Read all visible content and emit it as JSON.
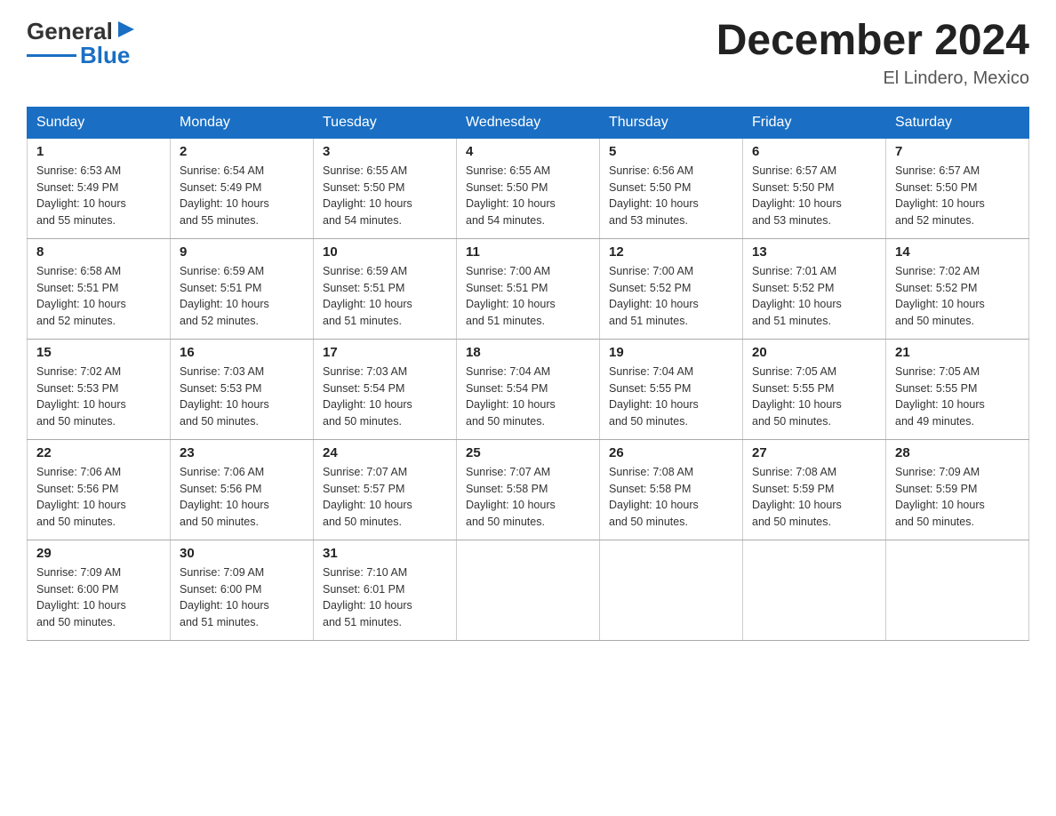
{
  "logo": {
    "text_general": "General",
    "text_blue": "Blue"
  },
  "header": {
    "month_title": "December 2024",
    "location": "El Lindero, Mexico"
  },
  "days_of_week": [
    "Sunday",
    "Monday",
    "Tuesday",
    "Wednesday",
    "Thursday",
    "Friday",
    "Saturday"
  ],
  "weeks": [
    [
      {
        "day": "1",
        "sunrise": "6:53 AM",
        "sunset": "5:49 PM",
        "daylight": "10 hours and 55 minutes."
      },
      {
        "day": "2",
        "sunrise": "6:54 AM",
        "sunset": "5:49 PM",
        "daylight": "10 hours and 55 minutes."
      },
      {
        "day": "3",
        "sunrise": "6:55 AM",
        "sunset": "5:50 PM",
        "daylight": "10 hours and 54 minutes."
      },
      {
        "day": "4",
        "sunrise": "6:55 AM",
        "sunset": "5:50 PM",
        "daylight": "10 hours and 54 minutes."
      },
      {
        "day": "5",
        "sunrise": "6:56 AM",
        "sunset": "5:50 PM",
        "daylight": "10 hours and 53 minutes."
      },
      {
        "day": "6",
        "sunrise": "6:57 AM",
        "sunset": "5:50 PM",
        "daylight": "10 hours and 53 minutes."
      },
      {
        "day": "7",
        "sunrise": "6:57 AM",
        "sunset": "5:50 PM",
        "daylight": "10 hours and 52 minutes."
      }
    ],
    [
      {
        "day": "8",
        "sunrise": "6:58 AM",
        "sunset": "5:51 PM",
        "daylight": "10 hours and 52 minutes."
      },
      {
        "day": "9",
        "sunrise": "6:59 AM",
        "sunset": "5:51 PM",
        "daylight": "10 hours and 52 minutes."
      },
      {
        "day": "10",
        "sunrise": "6:59 AM",
        "sunset": "5:51 PM",
        "daylight": "10 hours and 51 minutes."
      },
      {
        "day": "11",
        "sunrise": "7:00 AM",
        "sunset": "5:51 PM",
        "daylight": "10 hours and 51 minutes."
      },
      {
        "day": "12",
        "sunrise": "7:00 AM",
        "sunset": "5:52 PM",
        "daylight": "10 hours and 51 minutes."
      },
      {
        "day": "13",
        "sunrise": "7:01 AM",
        "sunset": "5:52 PM",
        "daylight": "10 hours and 51 minutes."
      },
      {
        "day": "14",
        "sunrise": "7:02 AM",
        "sunset": "5:52 PM",
        "daylight": "10 hours and 50 minutes."
      }
    ],
    [
      {
        "day": "15",
        "sunrise": "7:02 AM",
        "sunset": "5:53 PM",
        "daylight": "10 hours and 50 minutes."
      },
      {
        "day": "16",
        "sunrise": "7:03 AM",
        "sunset": "5:53 PM",
        "daylight": "10 hours and 50 minutes."
      },
      {
        "day": "17",
        "sunrise": "7:03 AM",
        "sunset": "5:54 PM",
        "daylight": "10 hours and 50 minutes."
      },
      {
        "day": "18",
        "sunrise": "7:04 AM",
        "sunset": "5:54 PM",
        "daylight": "10 hours and 50 minutes."
      },
      {
        "day": "19",
        "sunrise": "7:04 AM",
        "sunset": "5:55 PM",
        "daylight": "10 hours and 50 minutes."
      },
      {
        "day": "20",
        "sunrise": "7:05 AM",
        "sunset": "5:55 PM",
        "daylight": "10 hours and 50 minutes."
      },
      {
        "day": "21",
        "sunrise": "7:05 AM",
        "sunset": "5:55 PM",
        "daylight": "10 hours and 49 minutes."
      }
    ],
    [
      {
        "day": "22",
        "sunrise": "7:06 AM",
        "sunset": "5:56 PM",
        "daylight": "10 hours and 50 minutes."
      },
      {
        "day": "23",
        "sunrise": "7:06 AM",
        "sunset": "5:56 PM",
        "daylight": "10 hours and 50 minutes."
      },
      {
        "day": "24",
        "sunrise": "7:07 AM",
        "sunset": "5:57 PM",
        "daylight": "10 hours and 50 minutes."
      },
      {
        "day": "25",
        "sunrise": "7:07 AM",
        "sunset": "5:58 PM",
        "daylight": "10 hours and 50 minutes."
      },
      {
        "day": "26",
        "sunrise": "7:08 AM",
        "sunset": "5:58 PM",
        "daylight": "10 hours and 50 minutes."
      },
      {
        "day": "27",
        "sunrise": "7:08 AM",
        "sunset": "5:59 PM",
        "daylight": "10 hours and 50 minutes."
      },
      {
        "day": "28",
        "sunrise": "7:09 AM",
        "sunset": "5:59 PM",
        "daylight": "10 hours and 50 minutes."
      }
    ],
    [
      {
        "day": "29",
        "sunrise": "7:09 AM",
        "sunset": "6:00 PM",
        "daylight": "10 hours and 50 minutes."
      },
      {
        "day": "30",
        "sunrise": "7:09 AM",
        "sunset": "6:00 PM",
        "daylight": "10 hours and 51 minutes."
      },
      {
        "day": "31",
        "sunrise": "7:10 AM",
        "sunset": "6:01 PM",
        "daylight": "10 hours and 51 minutes."
      },
      null,
      null,
      null,
      null
    ]
  ],
  "labels": {
    "sunrise": "Sunrise:",
    "sunset": "Sunset:",
    "daylight": "Daylight:"
  }
}
